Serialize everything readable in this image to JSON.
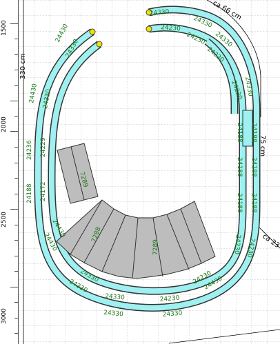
{
  "ruler": {
    "labels": [
      {
        "text": "1500"
      },
      {
        "text": "2000"
      },
      {
        "text": "2500"
      },
      {
        "text": "3000"
      }
    ]
  },
  "dimensions": {
    "width_label": "330 cm",
    "depth_label": "75 cm",
    "right_top_label": "ca 66 cm",
    "right_bottom_label": "ca 23"
  },
  "track_labels": {
    "top_a": "24330",
    "top_b": "24230",
    "top_c": "24330",
    "top_d": "24230",
    "top_e": "24330",
    "top_f": "24230",
    "top_g": "24330",
    "top_h": "24230",
    "left_a": "24430",
    "left_b": "24330",
    "left_c": "24430",
    "left_d": "24330",
    "left_e": "24236",
    "left_f": "24229",
    "left_g": "24188",
    "left_h": "24172",
    "right_a": "24188",
    "right_b": "24188",
    "right_c": "24188",
    "right_d": "24188",
    "right_e": "24188",
    "right_f": "24188",
    "right_g": "24230",
    "right_h": "24230",
    "right_i": "24330",
    "right_j": "24430",
    "right_k": "24430",
    "bot_a": "24330",
    "bot_b": "24330",
    "bot_c": "24230",
    "bot_d": "24330",
    "bot_e": "24430",
    "bot_f": "24330",
    "bot_g": "24230",
    "bot_h": "24330",
    "bot_i": "24430",
    "bot_j": "24430",
    "turntable_small": "7289",
    "turntable_large_1": "7288",
    "turntable_large_2": "7289"
  },
  "colors": {
    "track": "#9ff0f0",
    "track_edge": "#6ad6d6",
    "ballast": "#bdbdbd",
    "grid": "#c8c8c8",
    "label": "#1a7a1a",
    "endpoint": "#f2e000"
  }
}
